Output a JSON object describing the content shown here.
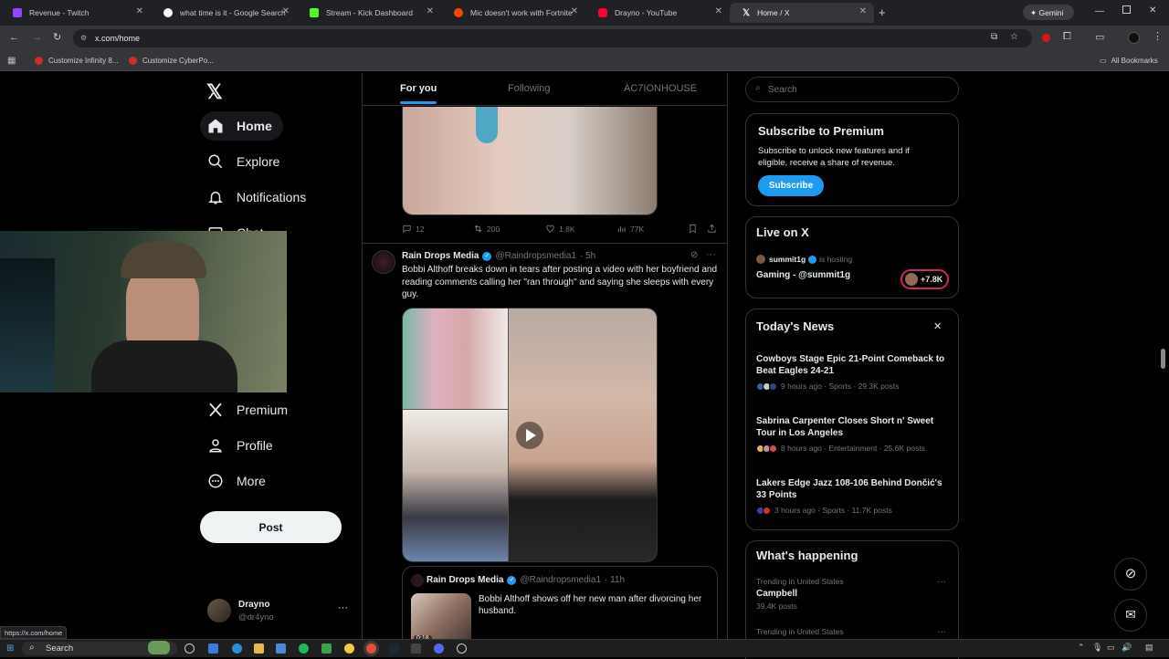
{
  "browser": {
    "tabs": [
      {
        "label": "Revenue - Twitch",
        "color": "#9146ff"
      },
      {
        "label": "what time is it - Google Search",
        "color": "#ffffff"
      },
      {
        "label": "Stream - Kick Dashboard",
        "color": "#53fc18"
      },
      {
        "label": "Mic doesn't work with Fortnite",
        "color": "#ff4500"
      },
      {
        "label": "Drayno - YouTube",
        "color": "#ff0033"
      },
      {
        "label": "Home / X",
        "color": "#ffffff"
      }
    ],
    "gemini_label": "Gemini",
    "url": "x.com/home",
    "bookmarks": [
      "Customize Infinity 8...",
      "Customize CyberPo..."
    ],
    "all_bookmarks": "All Bookmarks",
    "status_url": "https://x.com/home"
  },
  "sidebar": {
    "nav": [
      {
        "label": "Home",
        "icon": "home-icon"
      },
      {
        "label": "Explore",
        "icon": "search-icon"
      },
      {
        "label": "Notifications",
        "icon": "bell-icon"
      },
      {
        "label": "Chat",
        "icon": "chat-icon"
      },
      {
        "label": "ks",
        "icon": "bookmark-icon"
      },
      {
        "label": "ities",
        "icon": "communities-icon"
      },
      {
        "label": "Premium",
        "icon": "x-icon"
      },
      {
        "label": "Profile",
        "icon": "person-icon"
      },
      {
        "label": "More",
        "icon": "more-icon"
      }
    ],
    "post_button": "Post",
    "account": {
      "name": "Drayno",
      "handle": "@dr4yno"
    }
  },
  "feed": {
    "tabs": [
      "For you",
      "Following",
      "AC7IONHOUSE"
    ],
    "prev_post_actions": {
      "replies": "12",
      "reposts": "200",
      "likes": "1.8K",
      "views": "77K"
    },
    "post": {
      "author": "Rain Drops Media",
      "handle": "@Raindropsmedia1",
      "time": "· 5h",
      "text": "Bobbi Althoff breaks down in tears after posting a video with her boyfriend and reading comments calling her \"ran through\" and saying she sleeps with every guy.",
      "quote": {
        "author": "Rain Drops Media",
        "handle": "@Raindropsmedia1",
        "time": "· 11h",
        "text": "Bobbi Althoff shows off her new man after divorcing her husband.",
        "duration": "0:18"
      }
    }
  },
  "right": {
    "search_placeholder": "Search",
    "premium": {
      "title": "Subscribe to Premium",
      "body": "Subscribe to unlock new features and if eligible, receive a share of revenue.",
      "button": "Subscribe"
    },
    "live": {
      "title": "Live on X",
      "host": "summit1g",
      "hosting": "is hosting",
      "stream": "Gaming - @summit1g",
      "viewers": "+7.8K"
    },
    "news": {
      "title": "Today's News",
      "items": [
        {
          "headline": "Cowboys Stage Epic 21-Point Comeback to Beat Eagles 24-21",
          "meta": "9 hours ago · Sports · 29.3K posts"
        },
        {
          "headline": "Sabrina Carpenter Closes Short n' Sweet Tour in Los Angeles",
          "meta": "8 hours ago · Entertainment · 25.6K posts"
        },
        {
          "headline": "Lakers Edge Jazz 108-106 Behind Dončić's 33 Points",
          "meta": "3 hours ago · Sports · 11.7K posts"
        }
      ]
    },
    "happening": {
      "title": "What's happening",
      "trends": [
        {
          "context": "Trending in United States",
          "name": "Campbell",
          "count": "39.4K posts"
        },
        {
          "context": "Trending in United States",
          "name": "",
          "count": ""
        }
      ]
    }
  },
  "taskbar": {
    "search_label": "Search"
  },
  "colors": {
    "accent": "#1d9bf0",
    "background": "#000000",
    "border": "#2f3336",
    "muted": "#71767b"
  }
}
